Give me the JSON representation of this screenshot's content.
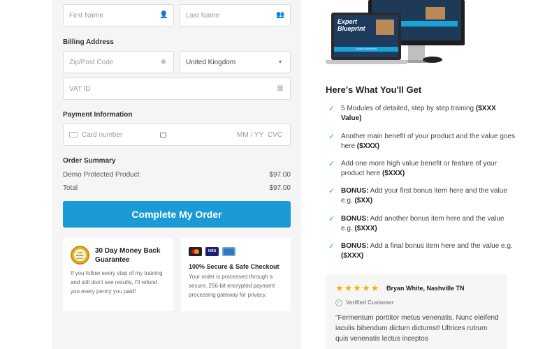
{
  "form": {
    "first_name_placeholder": "First Name",
    "last_name_placeholder": "Last Name",
    "billing_label": "Billing Address",
    "zip_placeholder": "Zip/Post Code",
    "country_value": "United Kingdom",
    "vat_placeholder": "VAT ID",
    "payment_label": "Payment Information",
    "card_placeholder": "Card number",
    "expiry_placeholder": "MM / YY",
    "cvc_placeholder": "CVC"
  },
  "summary": {
    "label": "Order Summary",
    "rows": [
      {
        "name": "Demo Protected Product",
        "price": "$97.00"
      },
      {
        "name": "Total",
        "price": "$97.00"
      }
    ]
  },
  "cta_label": "Complete My Order",
  "guarantee": {
    "badge_text": "100% MONEY BACK",
    "title": "30 Day Money Back Guarantee",
    "text": "If you follow every step of my training and still don't see results, I'll refund you every penny you paid!"
  },
  "secure": {
    "title": "100% Secure & Safe Checkout",
    "text": "Your order is processed through a secure, 256-bit encrypted payment processing gateway for privacy.",
    "cards": [
      "mastercard-icon",
      "visa-icon",
      "amex-icon"
    ]
  },
  "product": {
    "title_line1": "Expert",
    "title_line2": "Blueprint",
    "author": "CHARLIE BROWNING"
  },
  "benefits": {
    "heading": "Here's What You'll Get",
    "items": [
      {
        "text": "5 Modules of detailed, step by step training ",
        "bold": "($XXX Value)"
      },
      {
        "text": "Another main benefit of your product and the value goes here ",
        "bold": "($XXX)"
      },
      {
        "text": "Add one more high value benefit or feature of your product here ",
        "bold": "($XXX)"
      },
      {
        "prefix": "BONUS:",
        "text": " Add your first bonus item here and the value e.g. ",
        "bold": "($XX)"
      },
      {
        "prefix": "BONUS:",
        "text": " Add another bonus item here and the value e.g. ",
        "bold": "($XXX)"
      },
      {
        "prefix": "BONUS:",
        "text": " Add a final bonus item here and the value e.g. ",
        "bold": "($XXX)"
      }
    ]
  },
  "review": {
    "stars": "★★★★★",
    "name": "Bryan White, Nashville TN",
    "verified": "Verified Customer",
    "text": "\"Fermentum porttitor metus venenatis. Nunc eleifend iaculis bibendum dictum dictumst! Ultrices rutrum quis venenatis lectus inceptos"
  },
  "colors": {
    "accent": "#1a9bd7",
    "check": "#2aa3c8",
    "star": "#f5b300",
    "panel": "#f5f5f5"
  }
}
